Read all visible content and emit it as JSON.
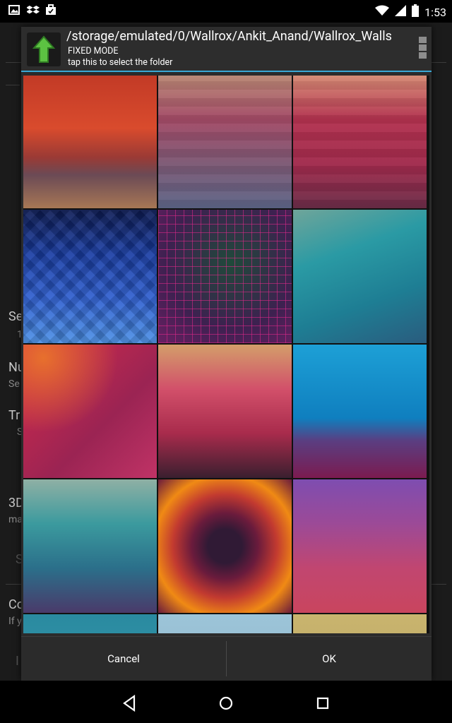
{
  "status_bar": {
    "time": "1:53",
    "icons": [
      "photo-icon",
      "dropbox-icon",
      "briefcase-icon",
      "wifi-icon",
      "signal-icon",
      "battery-icon"
    ]
  },
  "background": {
    "partial_items": [
      {
        "label": "Se",
        "sub": "1"
      },
      {
        "label": "Nu",
        "sub": "Se"
      },
      {
        "label": "Tr",
        "sub": "S"
      },
      {
        "label": "3D",
        "sub": "ma"
      },
      {
        "label": "S",
        "sub": ""
      },
      {
        "label": "Co",
        "sub": "If y"
      },
      {
        "label": "I",
        "sub": ""
      }
    ]
  },
  "dialog": {
    "path": "/storage/emulated/0/Wallrox/Ankit_Anand/Wallrox_Walls",
    "mode": "FIXED MODE",
    "hint": "tap this to select the folder",
    "cancel_label": "Cancel",
    "ok_label": "OK",
    "accent_color": "#3aa9d6"
  },
  "wallpapers": [
    {
      "name": "red-polygon-symmetry",
      "colors": [
        "#c23a26",
        "#d94b2d",
        "#9a3a35",
        "#6b4a55",
        "#a77755"
      ]
    },
    {
      "name": "sunset-stripes",
      "colors": [
        "#b98774",
        "#a24a66",
        "#7c5874",
        "#5c6486"
      ]
    },
    {
      "name": "coral-magenta-bands",
      "colors": [
        "#d68b74",
        "#b2324f",
        "#a12a4c",
        "#6a2c47"
      ]
    },
    {
      "name": "blue-chevrons",
      "colors": [
        "#0e1c55",
        "#1a3ea5",
        "#2f5fcf",
        "#4c90e5"
      ]
    },
    {
      "name": "purple-grid",
      "colors": [
        "#2b1d3c",
        "#3d2150",
        "#6a1f63",
        "#b21b78"
      ]
    },
    {
      "name": "teal-gradient",
      "colors": [
        "#6fa59a",
        "#2a9aa4",
        "#1e7e94",
        "#2a5c7e"
      ]
    },
    {
      "name": "crimson-low-poly",
      "colors": [
        "#e7702d",
        "#d52a4b",
        "#9b2453",
        "#c03366"
      ]
    },
    {
      "name": "peach-magenta-gradient",
      "colors": [
        "#d39e6a",
        "#d2506a",
        "#a82b4c",
        "#3a1f2f"
      ]
    },
    {
      "name": "sky-cells",
      "colors": [
        "#1da0d6",
        "#0f7fbf",
        "#5a3e81",
        "#7b1b50"
      ]
    },
    {
      "name": "teal-indigo-blur",
      "colors": [
        "#8fb0a4",
        "#3b9a9e",
        "#2b6f8a",
        "#4a3a6a"
      ]
    },
    {
      "name": "ember-cells",
      "colors": [
        "#f08a14",
        "#c23a30",
        "#6a1b3c",
        "#301a35"
      ]
    },
    {
      "name": "violet-rose-gradient",
      "colors": [
        "#7e4db0",
        "#9c4a97",
        "#c14670",
        "#c9455e"
      ]
    },
    {
      "name": "partial-teal",
      "colors": [
        "#2a8aa0",
        "#3aa0b0"
      ]
    },
    {
      "name": "partial-skyblue",
      "colors": [
        "#9cc4d8",
        "#8fb4c8"
      ]
    },
    {
      "name": "partial-khaki",
      "colors": [
        "#c9b46e",
        "#b5a262"
      ]
    }
  ]
}
